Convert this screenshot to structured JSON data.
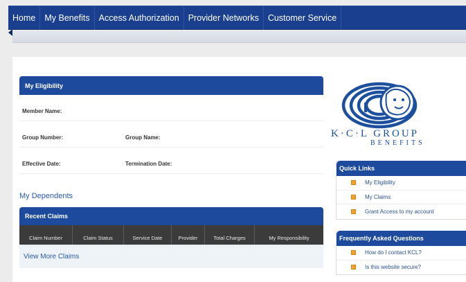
{
  "nav": {
    "items": [
      "Home",
      "My Benefits",
      "Access Authorization",
      "Provider Networks",
      "Customer Service"
    ]
  },
  "eligibility": {
    "title": "My Eligibility",
    "member_name_label": "Member Name:",
    "group_number_label": "Group Number:",
    "group_name_label": "Group Name:",
    "effective_date_label": "Effective Date:",
    "termination_date_label": "Termination Date:"
  },
  "dependents": {
    "link": "My Dependents"
  },
  "recent_claims": {
    "title": "Recent Claims",
    "columns": [
      "Claim Number",
      "Claim Status",
      "Service Date",
      "Provider",
      "Total Charges",
      "My Responsibility"
    ],
    "view_more": "View More Claims"
  },
  "logo": {
    "line1": "K·C·L GROUP",
    "line2": "BENEFITS"
  },
  "quick_links": {
    "title": "Quick Links",
    "items": [
      "My Eligibility",
      "My Claims",
      "Grant Access to my account"
    ]
  },
  "faq": {
    "title": "Frequently Asked Questions",
    "items": [
      "How do I contact KCL?",
      "Is this website secure?"
    ]
  },
  "colors": {
    "nav_bg": "#1a3f8e",
    "panel_header": "#1e4a9e",
    "table_header": "#3b3b3b",
    "bullet": "#f0a22b",
    "link": "#2a5aa8"
  }
}
